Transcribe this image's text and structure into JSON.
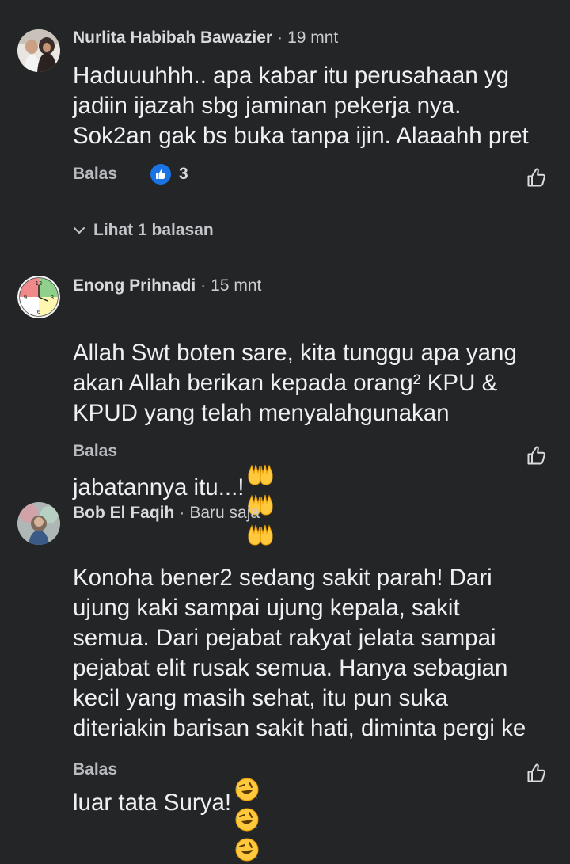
{
  "comments": [
    {
      "author": "Nurlita Habibah Bawazier",
      "separator": "·",
      "time": "19 mnt",
      "text": "Haduuuhhh.. apa kabar itu perusahaan yg\njadiin ijazah sbg jaminan pekerja nya.\nSok2an gak bs buka tanpa ijin. Alaaahh pret",
      "reply_label": "Balas",
      "reaction_icon": "like-reaction-icon",
      "reaction_count": "3"
    },
    {
      "author": "Enong Prihnadi",
      "separator": "·",
      "time": "15 mnt",
      "text": "Allah Swt boten sare, kita tunggu apa yang\nakan Allah berikan kepada orang² KPU &\nKPUD yang telah menyalahgunakan\njabatannya itu...!",
      "emoji": [
        "raising-hands-emoji",
        "raising-hands-emoji",
        "raising-hands-emoji"
      ],
      "reply_label": "Balas"
    },
    {
      "author": "Bob El Faqih",
      "separator": "·",
      "time": "Baru saja",
      "text": "Konoha bener2 sedang sakit parah! Dari\nujung kaki sampai ujung kepala, sakit\nsemua. Dari pejabat rakyat jelata sampai\npejabat elit rusak semua. Hanya sebagian\nkecil yang masih sehat, itu pun suka\nditeriakin barisan sakit hati, diminta pergi ke\nluar tata Surya!",
      "emoji": [
        "rolling-laughing-emoji",
        "rolling-laughing-emoji",
        "rolling-laughing-emoji"
      ],
      "reply_label": "Balas"
    }
  ],
  "view_replies_label": "Lihat 1 balasan",
  "colors": {
    "background": "#242526",
    "text": "#e4e6eb",
    "secondary_text": "#b0b3b8",
    "like_blue": "#1b74e4"
  }
}
